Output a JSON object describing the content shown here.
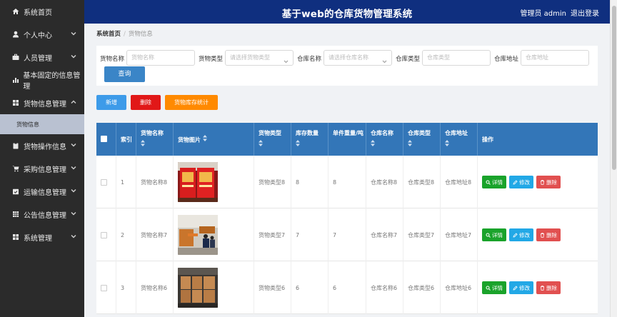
{
  "app": {
    "title": "基于web的仓库货物管理系统",
    "user_label": "管理员 admin",
    "logout_label": "退出登录"
  },
  "sidebar": {
    "items": [
      {
        "label": "系统首页",
        "icon": "home-icon",
        "has_children": false
      },
      {
        "label": "个人中心",
        "icon": "user-icon",
        "has_children": true
      },
      {
        "label": "人员管理",
        "icon": "briefcase-icon",
        "has_children": true
      },
      {
        "label": "基本固定的信息管理",
        "icon": "bar-chart-icon",
        "has_children": false
      },
      {
        "label": "货物信息管理",
        "icon": "grid-icon",
        "has_children": true,
        "open": true
      },
      {
        "label": "货物操作信息",
        "icon": "clipboard-icon",
        "has_children": true
      },
      {
        "label": "采购信息管理",
        "icon": "cart-icon",
        "has_children": true
      },
      {
        "label": "运输信息管理",
        "icon": "calendar-check-icon",
        "has_children": true
      },
      {
        "label": "公告信息管理",
        "icon": "table-icon",
        "has_children": true
      },
      {
        "label": "系统管理",
        "icon": "grid-icon",
        "has_children": true
      }
    ],
    "subitem": "货物信息"
  },
  "breadcrumb": {
    "home": "系统首页",
    "current": "货物信息"
  },
  "search": {
    "fields": [
      {
        "label": "货物名称",
        "placeholder": "货物名称",
        "type": "input"
      },
      {
        "label": "货物类型",
        "placeholder": "请选择货物类型",
        "type": "select"
      },
      {
        "label": "仓库名称",
        "placeholder": "请选择仓库名称",
        "type": "select"
      },
      {
        "label": "仓库类型",
        "placeholder": "仓库类型",
        "type": "input"
      },
      {
        "label": "仓库地址",
        "placeholder": "仓库地址",
        "type": "input"
      }
    ],
    "query_label": "查询"
  },
  "actions": {
    "add": "新增",
    "delete": "删除",
    "stats": "货物库存统计"
  },
  "colors": {
    "header_bg": "#0f2f7f",
    "sidebar_bg": "#2b2b2b",
    "table_head": "#3376b8",
    "add": "#3d9be9",
    "delete": "#e11818",
    "stats": "#ff8a00",
    "detail": "#1aa32b",
    "edit": "#22a8e6",
    "remove": "#e15050"
  },
  "table": {
    "columns": [
      "",
      "索引",
      "货物名称",
      "货物图片",
      "货物类型",
      "库存数量",
      "单件重量/吨",
      "仓库名称",
      "仓库类型",
      "仓库地址",
      "操作"
    ],
    "row_buttons": {
      "detail": "详情",
      "edit": "修改",
      "remove": "删除"
    },
    "rows": [
      {
        "index": "1",
        "name": "货物名称8",
        "type": "货物类型8",
        "stock": "8",
        "weight": "8",
        "wh_name": "仓库名称8",
        "wh_type": "仓库类型8",
        "wh_addr": "仓库地址8",
        "photo": "red-cabinet-photo"
      },
      {
        "index": "2",
        "name": "货物名称7",
        "type": "货物类型7",
        "stock": "7",
        "weight": "7",
        "wh_name": "仓库名称7",
        "wh_type": "仓库类型7",
        "wh_addr": "仓库地址7",
        "photo": "warehouse-workers-photo"
      },
      {
        "index": "3",
        "name": "货物名称6",
        "type": "货物类型6",
        "stock": "6",
        "weight": "6",
        "wh_name": "仓库名称6",
        "wh_type": "仓库类型6",
        "wh_addr": "仓库地址6",
        "photo": "boxes-stack-photo"
      }
    ]
  }
}
